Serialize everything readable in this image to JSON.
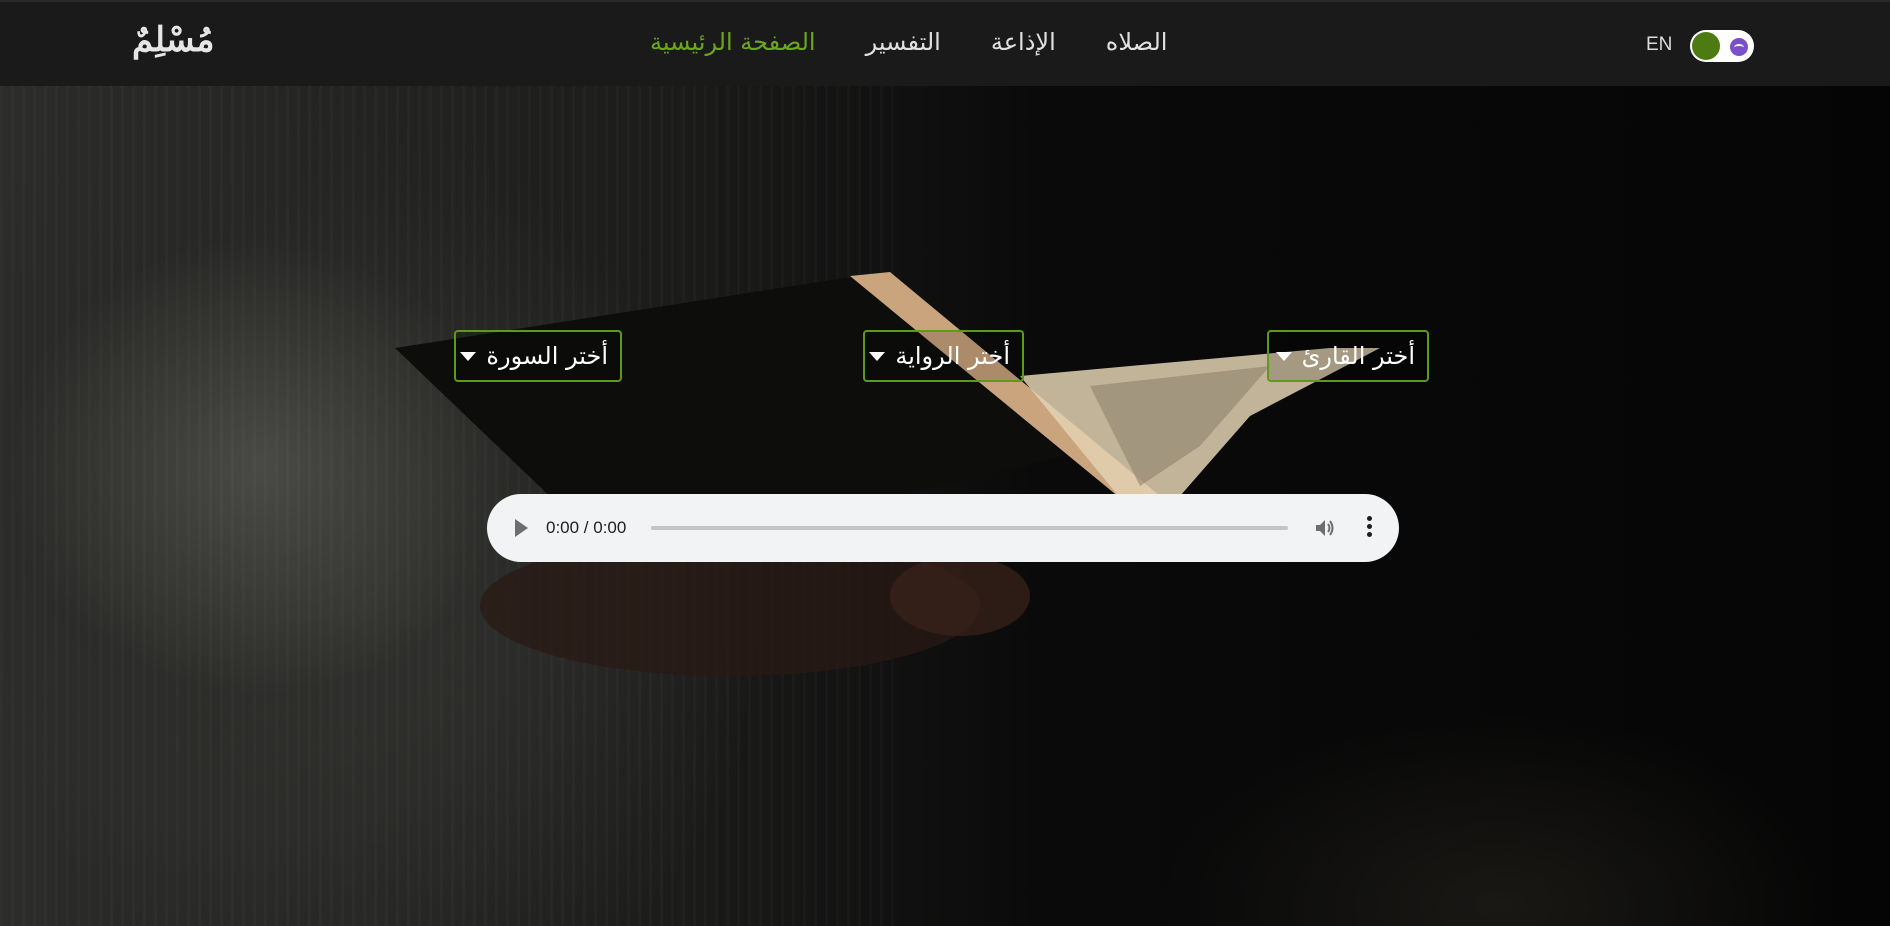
{
  "navbar": {
    "logo": "مُسْلِمٌ",
    "links": [
      {
        "label": "الصفحة الرئيسية",
        "active": true
      },
      {
        "label": "التفسير",
        "active": false
      },
      {
        "label": "الإذاعة",
        "active": false
      },
      {
        "label": "الصلاه",
        "active": false
      }
    ],
    "language": "EN",
    "theme_toggle": {
      "icons": [
        "theme-knob-icon",
        "moon-icon"
      ]
    }
  },
  "selectors": {
    "surah": {
      "label": "أختر السورة",
      "icon": "caret-down-icon"
    },
    "rewaya": {
      "label": "أختر الرواية",
      "icon": "caret-down-icon"
    },
    "reader": {
      "label": "أختر القارئ",
      "icon": "caret-down-icon"
    }
  },
  "audio_player": {
    "time": "0:00 / 0:00",
    "progress": 0,
    "icons": [
      "play-icon",
      "volume-icon",
      "more-vert-icon"
    ]
  },
  "colors": {
    "accent": "#6aa71f",
    "border_accent": "#5e9a19",
    "navbar_bg": "#1a1a1b",
    "player_bg": "#f1f3f4"
  }
}
